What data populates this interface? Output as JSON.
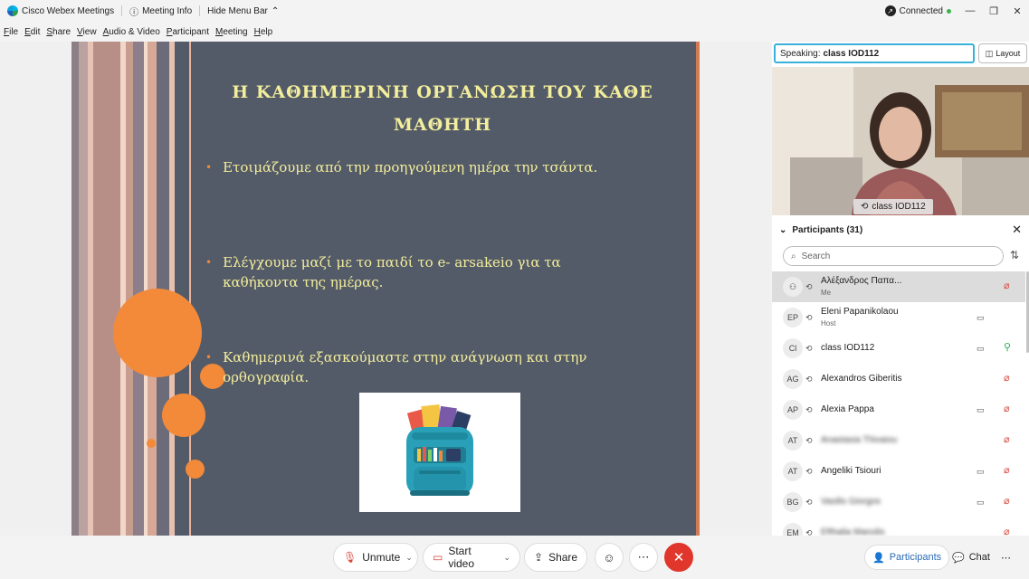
{
  "titlebar": {
    "app_title": "Cisco Webex Meetings",
    "meeting_info": "Meeting Info",
    "hide_menu": "Hide Menu Bar",
    "status": "Connected"
  },
  "menu": [
    "File",
    "Edit",
    "Share",
    "View",
    "Audio & Video",
    "Participant",
    "Meeting",
    "Help"
  ],
  "slide": {
    "title": "Η ΚΑΘΗΜΕΡΙΝΗ ΟΡΓΑΝΩΣΗ ΤΟΥ ΚΑΘΕ ΜΑΘΗΤΗ",
    "bullets": [
      "Ετοιμάζουμε από την προηγούμενη ημέρα την τσάντα.",
      "Ελέγχουμε μαζί με το παιδί το e- arsakeio για τα καθήκοντα της ημέρας.",
      "Καθημερινά εξασκούμαστε στην ανάγνωση και στην ορθογραφία."
    ]
  },
  "panel": {
    "speaking_label": "Speaking:",
    "speaking_name": "class IOD112",
    "layout_label": "Layout",
    "video_name": "class IOD112",
    "participants_title": "Participants (31)",
    "search_placeholder": "Search",
    "participants": [
      {
        "initials": "",
        "name": "Αλέξανδρος Παπα...",
        "sub": "Me",
        "video": false,
        "mic": "muted",
        "selected": true,
        "blurred": false
      },
      {
        "initials": "EP",
        "name": "Eleni Papanikolaou",
        "sub": "Host",
        "video": true,
        "mic": "none",
        "selected": false,
        "blurred": false
      },
      {
        "initials": "Cl",
        "name": "class IOD112",
        "sub": "",
        "video": true,
        "mic": "on",
        "selected": false,
        "blurred": false
      },
      {
        "initials": "AG",
        "name": "Alexandros Giberitis",
        "sub": "",
        "video": false,
        "mic": "muted",
        "selected": false,
        "blurred": false
      },
      {
        "initials": "AP",
        "name": "Alexia Pappa",
        "sub": "",
        "video": true,
        "mic": "muted",
        "selected": false,
        "blurred": false
      },
      {
        "initials": "AT",
        "name": "Anastasia Thivaiou",
        "sub": "",
        "video": false,
        "mic": "muted",
        "selected": false,
        "blurred": true
      },
      {
        "initials": "AT",
        "name": "Angeliki Tsiouri",
        "sub": "",
        "video": true,
        "mic": "muted",
        "selected": false,
        "blurred": false
      },
      {
        "initials": "BG",
        "name": "Vasilis Giorgos",
        "sub": "",
        "video": true,
        "mic": "muted",
        "selected": false,
        "blurred": true
      },
      {
        "initials": "EM",
        "name": "Efthalia Manolis",
        "sub": "",
        "video": false,
        "mic": "muted",
        "selected": false,
        "blurred": true
      }
    ]
  },
  "bottom": {
    "unmute": "Unmute",
    "start_video": "Start video",
    "share": "Share",
    "participants": "Participants",
    "chat": "Chat"
  },
  "colors": {
    "slide_bg": "#545b68",
    "slide_text": "#f3ee9c",
    "accent_orange": "#f28a3a",
    "end_red": "#e0362c",
    "speaking_border": "#38b2d8"
  }
}
